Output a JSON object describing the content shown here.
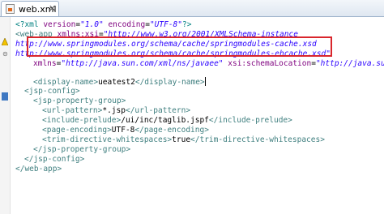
{
  "tab": {
    "title": "web.xml",
    "close": "✕"
  },
  "colors": {
    "tag": "#3f7f7f",
    "attribute": "#7f007f",
    "value": "#2a00ff",
    "highlight_border": "#d9262c"
  },
  "icons": {
    "tab_icon": "xml-file-icon",
    "warning_marker": "warning-icon",
    "fold_marker": "fold-icon",
    "bookmark_marker": "bookmark-icon"
  },
  "code": {
    "l1": {
      "open": "<?xml",
      "a1": " version",
      "eq1": "=",
      "v1": "\"1.0\"",
      "a2": " encoding",
      "eq2": "=",
      "v2": "\"UTF-8\"",
      "close": "?>"
    },
    "l2": {
      "open": "<web-app",
      "a1": " xmlns:xsi",
      "eq1": "=",
      "v1": "\"http://www.w3.org/2001/XMLSchema-instance"
    },
    "l3": "http://www.springmodules.org/schema/cache/springmodules-cache.xsd",
    "l4": "http://www.springmodules.org/schema/cache/springmodules-ehcache.xsd\"",
    "l5": {
      "a1": "xmlns",
      "eq1": "=",
      "v1": "\"http://java.sun.com/xml/ns/javaee\"",
      "a2": " xsi:schemaLocation",
      "eq2": "=",
      "v2": "\"http://java.sun.com/xml/n"
    },
    "l6": {
      "open": "<display-name>",
      "text": "ueatest2",
      "close": "</display-name>"
    },
    "l7": "<jsp-config>",
    "l8": "<jsp-property-group>",
    "l9": {
      "open": "<url-pattern>",
      "text": "*.jsp",
      "close": "</url-pattern>"
    },
    "l10": {
      "open": "<include-prelude>",
      "text": "/ui/inc/taglib.jspf",
      "close": "</include-prelude>"
    },
    "l11": {
      "open": "<page-encoding>",
      "text": "UTF-8",
      "close": "</page-encoding>"
    },
    "l12": {
      "open": "<trim-directive-whitespaces>",
      "text": "true",
      "close": "</trim-directive-whitespaces>"
    },
    "l13": "</jsp-property-group>",
    "l14": "</jsp-config>",
    "l15": "</web-app>"
  }
}
